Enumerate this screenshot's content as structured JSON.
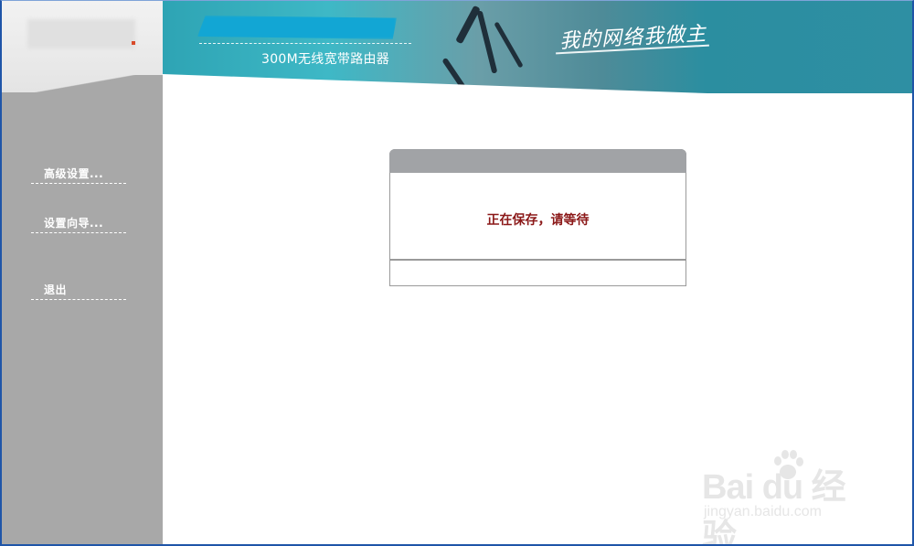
{
  "banner": {
    "product_name": "300M无线宽带路由器",
    "slogan": "我的网络我做主"
  },
  "sidebar": {
    "items": [
      {
        "label": "高级设置..."
      },
      {
        "label": "设置向导..."
      },
      {
        "label": "退出"
      }
    ]
  },
  "dialog": {
    "title": "",
    "message": "正在保存，请等待"
  },
  "watermark": {
    "brand": "Bai  du 经验",
    "url": "jingyan.baidu.com"
  },
  "colors": {
    "sidebar": "#a8a8a8",
    "banner_teal": "#2e8fa3",
    "message_red": "#8b1818",
    "frame_blue": "#1f55a8"
  }
}
